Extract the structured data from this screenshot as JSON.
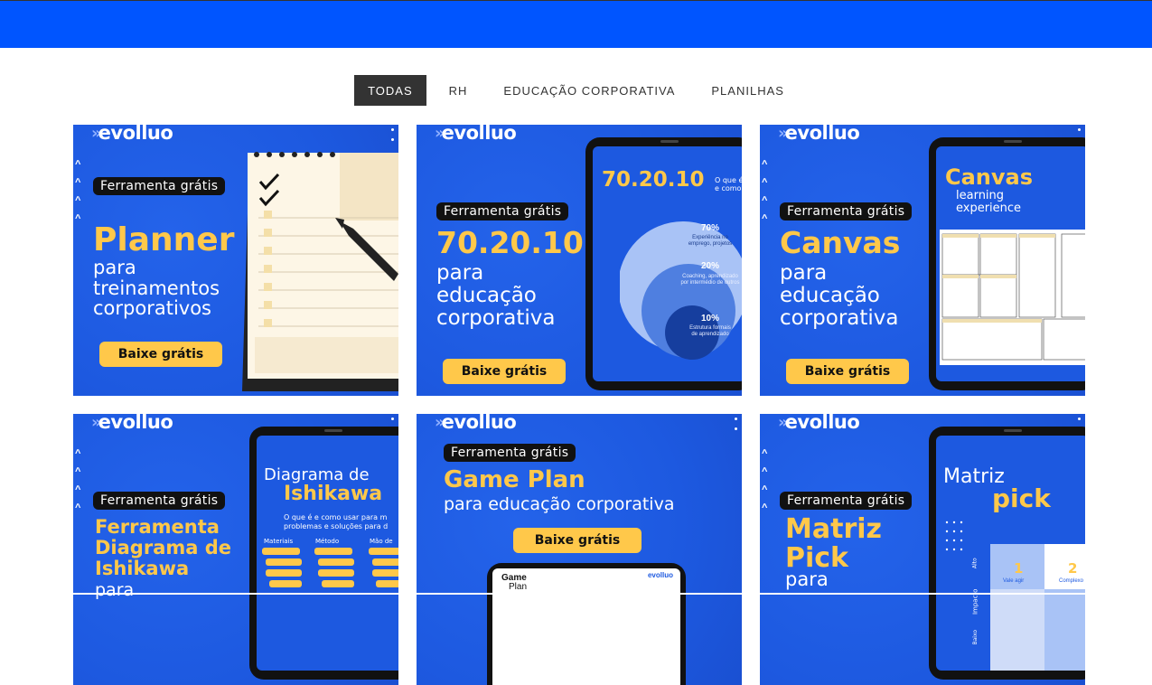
{
  "filters": [
    "TODAS",
    "RH",
    "EDUCAÇÃO CORPORATIVA",
    "PLANILHAS"
  ],
  "active_filter": "TODAS",
  "brand": {
    "logo_text": "evolluo",
    "blue": "#1d59e0",
    "yellow": "#ffc84a",
    "header_blue": "#0055ff"
  },
  "cards": [
    {
      "tag": "Ferramenta grátis",
      "title": "Planner",
      "subtitle": "para\ntreinamentos\ncorporativos",
      "cta": "Baixe grátis"
    },
    {
      "tag": "Ferramenta grátis",
      "title": "70.20.10",
      "subtitle": "para\neducação\ncorporativa",
      "cta": "Baixe grátis",
      "screen_title": "70.20.10",
      "screen_side": "O que é\ne como",
      "circles": [
        {
          "pct": "70%",
          "desc": "Experiência no\nemprego, projetos"
        },
        {
          "pct": "20%",
          "desc": "Coaching, aprendizado\npor intermédio de outros"
        },
        {
          "pct": "10%",
          "desc": "Estrutura formais\nde aprendizado"
        }
      ]
    },
    {
      "tag": "Ferramenta grátis",
      "title": "Canvas",
      "subtitle": "para\neducação\ncorporativa",
      "cta": "Baixe grátis",
      "screen_title": "Canvas",
      "screen_sub": "learning\nexperience"
    },
    {
      "tag": "Ferramenta grátis",
      "title": "Ferramenta\nDiagrama de\nIshikawa",
      "subtitle": "para",
      "screen_title_a": "Diagrama de",
      "screen_title_b": "Ishikawa",
      "screen_desc": "O que é e como usar para m\nproblemas e soluções para d",
      "screen_cols": [
        "Materiais",
        "Método",
        "Mão de"
      ]
    },
    {
      "tag": "Ferramenta grátis",
      "title": "Game Plan",
      "subtitle": "para educação corporativa",
      "cta": "Baixe grátis",
      "doc_title_a": "Game",
      "doc_title_b": "Plan",
      "doc_logo": "evolluo"
    },
    {
      "tag": "Ferramenta grátis",
      "title": "Matriz\nPick",
      "subtitle": "para",
      "screen_title_a": "Matriz",
      "screen_title_b": "pick",
      "matrix": [
        {
          "num": "1",
          "label": "Vale agir"
        },
        {
          "num": "2",
          "label": "Complexo"
        }
      ],
      "axis_high": "Alto",
      "axis_impact": "Impacto",
      "axis_low": "Baixo"
    }
  ]
}
